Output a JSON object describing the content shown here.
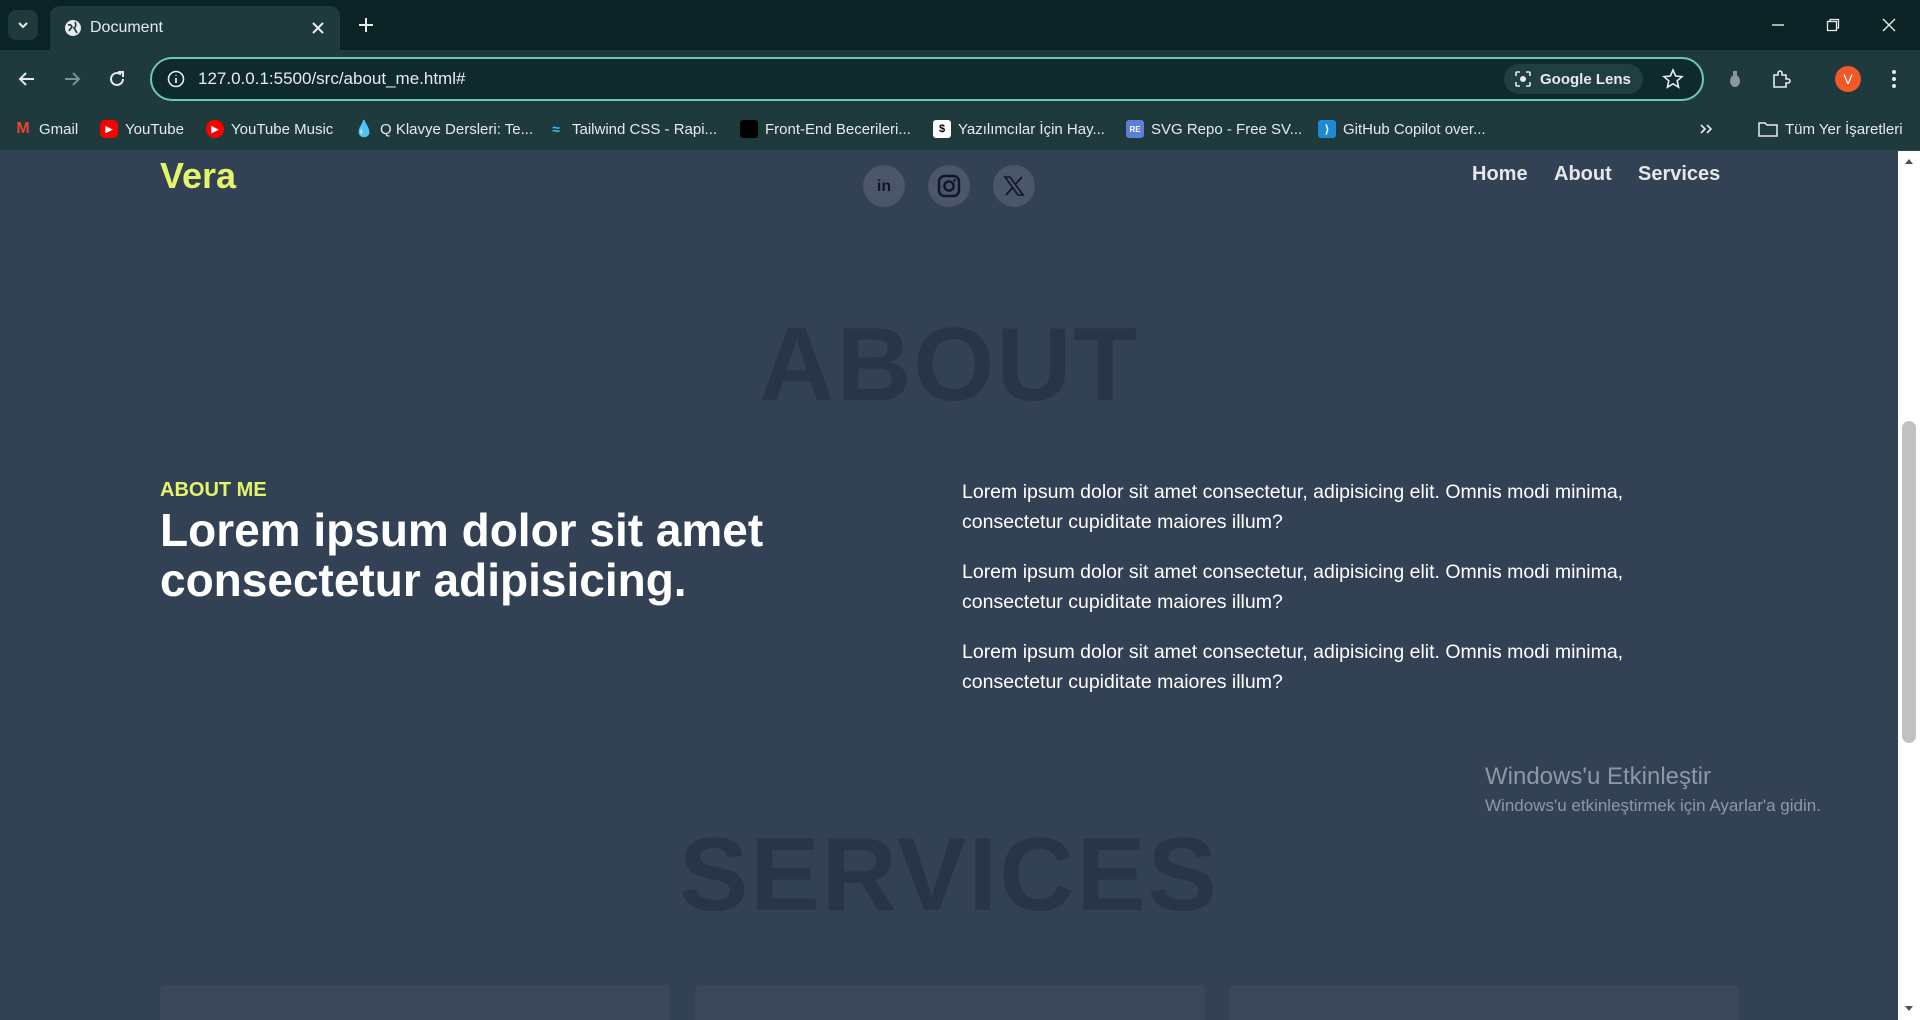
{
  "browser": {
    "tab_title": "Document",
    "url": "127.0.0.1:5500/src/about_me.html#",
    "lens_label": "Google Lens",
    "profile_initial": "V",
    "bookmarks": [
      {
        "label": "Gmail",
        "icon": "gmail-icon"
      },
      {
        "label": "YouTube",
        "icon": "youtube-icon"
      },
      {
        "label": "YouTube Music",
        "icon": "youtube-music-icon"
      },
      {
        "label": "Q Klavye Dersleri: Te...",
        "icon": "drop-icon"
      },
      {
        "label": "Tailwind CSS - Rapi...",
        "icon": "tailwind-icon"
      },
      {
        "label": "Front-End Becerileri...",
        "icon": "frontend-icon"
      },
      {
        "label": "Yazılımcılar İçin Hay...",
        "icon": "dollar-icon"
      },
      {
        "label": "SVG Repo - Free SV...",
        "icon": "svgrepo-icon"
      },
      {
        "label": "GitHub Copilot over...",
        "icon": "vscode-icon"
      }
    ],
    "all_bookmarks_label": "Tüm Yer İşaretleri"
  },
  "page": {
    "brand": "Vera",
    "social_icons": [
      "linkedin-icon",
      "instagram-icon",
      "x-icon"
    ],
    "nav": [
      "Home",
      "About",
      "Services"
    ],
    "about_heading": "ABOUT",
    "about_kicker": "ABOUT ME",
    "about_title": "Lorem ipsum dolor sit amet consectetur adipisicing.",
    "paragraphs": [
      "Lorem ipsum dolor sit amet consectetur, adipisicing elit. Omnis modi minima, consectetur cupiditate maiores illum?",
      "Lorem ipsum dolor sit amet consectetur, adipisicing elit. Omnis modi minima, consectetur cupiditate maiores illum?",
      "Lorem ipsum dolor sit amet consectetur, adipisicing elit. Omnis modi minima, consectetur cupiditate maiores illum?"
    ],
    "services_heading": "SERVICES"
  },
  "os_watermark": {
    "title": "Windows'u Etkinleştir",
    "subtitle": "Windows'u etkinleştirmek için Ayarlar'a gidin."
  },
  "colors": {
    "page_bg": "#334155",
    "accent": "#e4f56b",
    "browser_bg": "#1e3a3c"
  }
}
